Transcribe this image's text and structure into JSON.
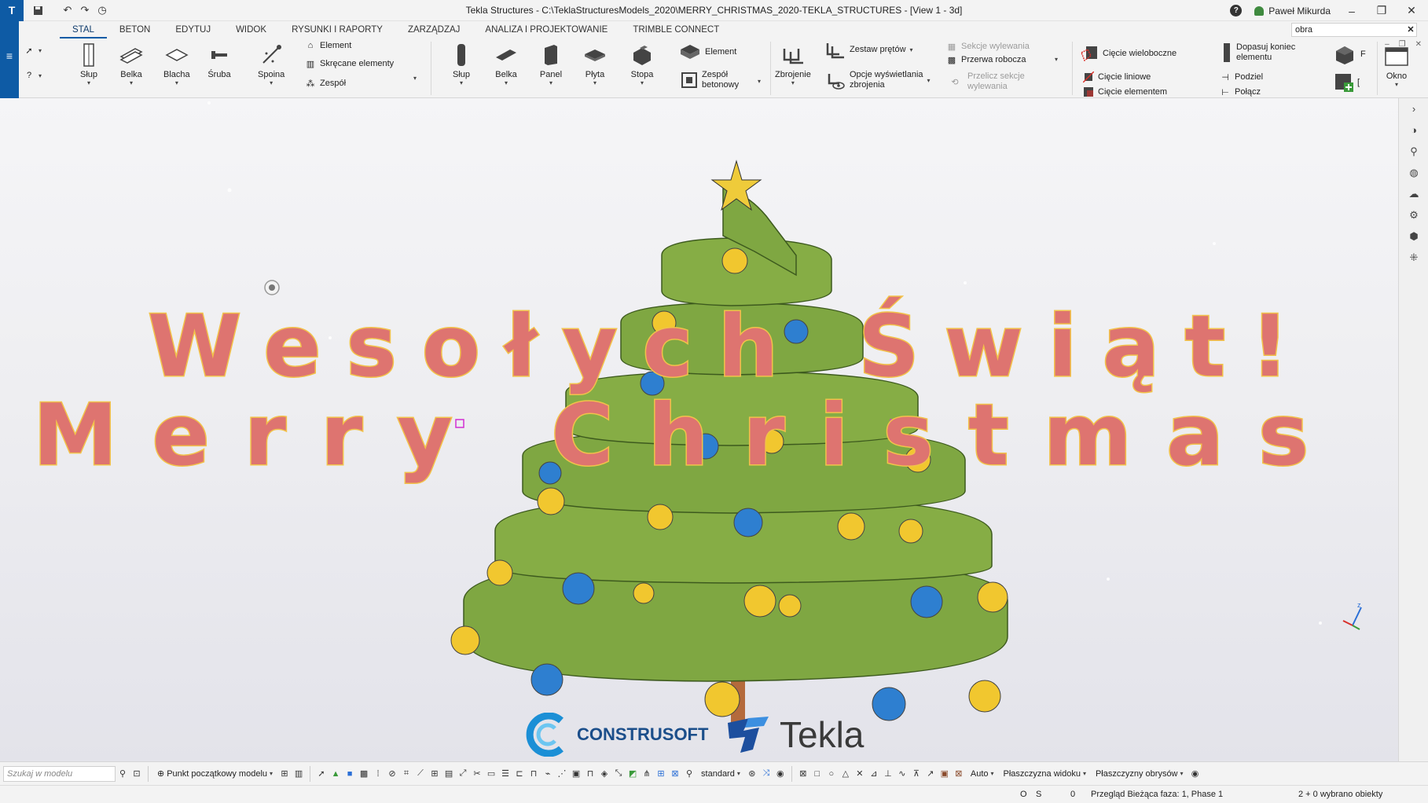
{
  "titlebar": {
    "title": "Tekla Structures - C:\\TeklaStructuresModels_2020\\MERRY_CHRISTMAS_2020-TEKLA_STRUCTURES - [View 1 - 3d]",
    "user": "Paweł Mikurda",
    "help": "?"
  },
  "tabs": [
    "STAL",
    "BETON",
    "EDYTUJ",
    "WIDOK",
    "RYSUNKI I RAPORTY",
    "ZARZĄDZAJ",
    "ANALIZA I PROJEKTOWANIE",
    "TRIMBLE CONNECT"
  ],
  "top_search": {
    "value": "obra"
  },
  "ribbon": {
    "steel": {
      "column": "Słup",
      "beam": "Belka",
      "plate": "Blacha",
      "bolt": "Śruba",
      "weld": "Spoina",
      "part": "Element",
      "bolted": "Skręcane elementy",
      "assembly": "Zespół"
    },
    "concrete": {
      "column": "Słup",
      "beam": "Belka",
      "panel": "Panel",
      "slab": "Płyta",
      "footing": "Stopa",
      "part": "Element",
      "cast_unit_l1": "Zespół",
      "cast_unit_l2": "betonowy"
    },
    "rebar": {
      "reinforcement": "Zbrojenie",
      "rebar_set": "Zestaw prętów",
      "display_l1": "Opcje wyświetlania",
      "display_l2": "zbrojenia",
      "pour_sections": "Sekcje wylewania",
      "pour_break": "Przerwa robocza",
      "recalc_l1": "Przelicz sekcje",
      "recalc_l2": "wylewania"
    },
    "edit": {
      "polygon_cut": "Cięcie wieloboczne",
      "line_cut": "Cięcie liniowe",
      "part_cut": "Cięcie elementem",
      "fit_l1": "Dopasuj koniec",
      "fit_l2": "elementu",
      "split": "Podziel",
      "combine": "Połącz",
      "more_a": "F",
      "more_b": "["
    },
    "window": "Okno"
  },
  "viewport": {
    "greeting_pl": "Wesołych Świąt!",
    "greeting_en": "Merry Christmas",
    "logo_construsoft": "CONSTRUSOFT",
    "logo_tekla": "Tekla",
    "axis_z": "z"
  },
  "bottombar": {
    "search_placeholder": "Szukaj w modelu",
    "origin": "Punkt początkowy modelu",
    "standard": "standard",
    "auto": "Auto",
    "view_plane": "Płaszczyzna widoku",
    "outline_planes": "Płaszczyzny obrysów"
  },
  "status": {
    "o": "O",
    "s": "S",
    "zero": "0",
    "phase": "Przegląd  Bieżąca faza: 1, Phase 1",
    "selected": "2 + 0 wybrano obiekty"
  },
  "colors": {
    "accent": "#0e5ba5",
    "tree_green": "#7aa13e",
    "ornament_yellow": "#f1c72f",
    "ornament_blue": "#2e7fd0",
    "greeting_fill": "#de7470",
    "greeting_stroke": "#f2c24a"
  }
}
